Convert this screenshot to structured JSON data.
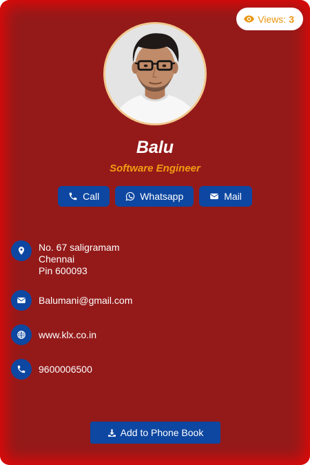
{
  "views": {
    "label": "Views:",
    "count": "3",
    "icon": "eye-icon"
  },
  "profile": {
    "name": "Balu",
    "title": "Software Engineer"
  },
  "actions": [
    {
      "label": "Call",
      "icon": "phone-icon"
    },
    {
      "label": "Whatsapp",
      "icon": "whatsapp-icon"
    },
    {
      "label": "Mail",
      "icon": "mail-icon"
    }
  ],
  "contact": {
    "address": [
      "No. 67 saligramam",
      "Chennai",
      "Pin 600093"
    ],
    "email": "Balumani@gmail.com",
    "website": "www.klx.co.in",
    "phone": "9600006500"
  },
  "add_button": {
    "label": "Add to Phone Book",
    "icon": "download-icon"
  },
  "colors": {
    "card_bg": "#941a1a",
    "card_glow": "#e00808",
    "accent_blue": "#0d47a1",
    "title_orange": "#f39c12",
    "views_orange": "#e8950f",
    "avatar_border": "#f2c98f"
  }
}
